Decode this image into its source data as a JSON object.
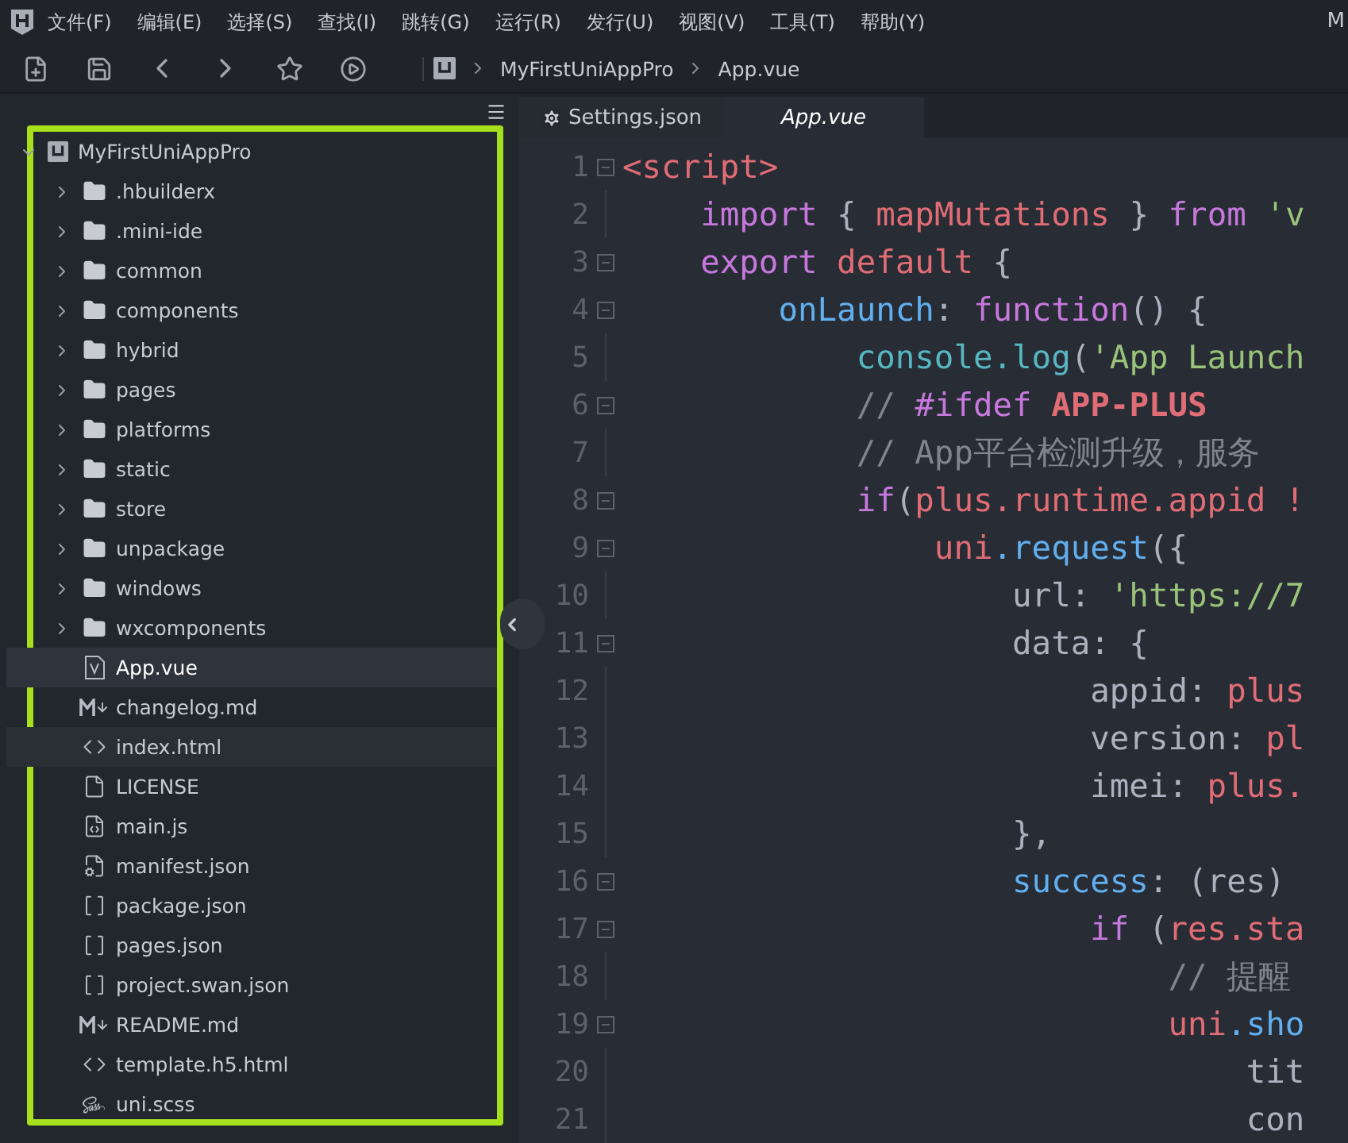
{
  "window": {
    "title": "M"
  },
  "menu": [
    "文件(F)",
    "编辑(E)",
    "选择(S)",
    "查找(I)",
    "跳转(G)",
    "运行(R)",
    "发行(U)",
    "视图(V)",
    "工具(T)",
    "帮助(Y)"
  ],
  "breadcrumb": [
    "MyFirstUniAppPro",
    "App.vue"
  ],
  "tabs": [
    {
      "label": "Settings.json",
      "kind": "settings",
      "selected": false,
      "preview": false
    },
    {
      "label": "App.vue",
      "kind": "file",
      "selected": true,
      "preview": true
    }
  ],
  "tree": {
    "label": "MyFirstUniAppPro",
    "expanded": true,
    "children": [
      {
        "label": ".hbuilderx",
        "kind": "folder",
        "expanded": false,
        "selected": false,
        "hovered": false
      },
      {
        "label": ".mini-ide",
        "kind": "folder",
        "expanded": false,
        "selected": false,
        "hovered": false
      },
      {
        "label": "common",
        "kind": "folder",
        "expanded": false,
        "selected": false,
        "hovered": false
      },
      {
        "label": "components",
        "kind": "folder",
        "expanded": false,
        "selected": false,
        "hovered": false
      },
      {
        "label": "hybrid",
        "kind": "folder",
        "expanded": false,
        "selected": false,
        "hovered": false
      },
      {
        "label": "pages",
        "kind": "folder",
        "expanded": false,
        "selected": false,
        "hovered": false
      },
      {
        "label": "platforms",
        "kind": "folder",
        "expanded": false,
        "selected": false,
        "hovered": false
      },
      {
        "label": "static",
        "kind": "folder",
        "expanded": false,
        "selected": false,
        "hovered": false
      },
      {
        "label": "store",
        "kind": "folder",
        "expanded": false,
        "selected": false,
        "hovered": false
      },
      {
        "label": "unpackage",
        "kind": "folder",
        "expanded": false,
        "selected": false,
        "hovered": false
      },
      {
        "label": "windows",
        "kind": "folder",
        "expanded": false,
        "selected": false,
        "hovered": false
      },
      {
        "label": "wxcomponents",
        "kind": "folder",
        "expanded": false,
        "selected": false,
        "hovered": false
      },
      {
        "label": "App.vue",
        "kind": "vue",
        "selected": true,
        "hovered": false
      },
      {
        "label": "changelog.md",
        "kind": "markdown",
        "selected": false,
        "hovered": false
      },
      {
        "label": "index.html",
        "kind": "html",
        "selected": false,
        "hovered": true
      },
      {
        "label": "LICENSE",
        "kind": "plain",
        "selected": false,
        "hovered": false
      },
      {
        "label": "main.js",
        "kind": "js",
        "selected": false,
        "hovered": false
      },
      {
        "label": "manifest.json",
        "kind": "manifest",
        "selected": false,
        "hovered": false
      },
      {
        "label": "package.json",
        "kind": "json",
        "selected": false,
        "hovered": false
      },
      {
        "label": "pages.json",
        "kind": "json",
        "selected": false,
        "hovered": false
      },
      {
        "label": "project.swan.json",
        "kind": "json",
        "selected": false,
        "hovered": false
      },
      {
        "label": "README.md",
        "kind": "markdown",
        "selected": false,
        "hovered": false
      },
      {
        "label": "template.h5.html",
        "kind": "html",
        "selected": false,
        "hovered": false
      },
      {
        "label": "uni.scss",
        "kind": "sass",
        "selected": false,
        "hovered": false
      }
    ]
  },
  "editor": {
    "lines": [
      {
        "number": "1",
        "fold": true,
        "tokens": [
          {
            "t": "<script>",
            "color": "#e06c75",
            "bold": false
          }
        ]
      },
      {
        "number": "2",
        "fold": false,
        "tokens": [
          {
            "t": "    import",
            "color": "#c678dd",
            "bold": false
          },
          {
            "t": " { ",
            "color": "#abb2bf",
            "bold": false
          },
          {
            "t": "mapMutations",
            "color": "#e06c75",
            "bold": false
          },
          {
            "t": " } ",
            "color": "#abb2bf",
            "bold": false
          },
          {
            "t": "from",
            "color": "#c678dd",
            "bold": false
          },
          {
            "t": " 'v",
            "color": "#98c379",
            "bold": false
          }
        ]
      },
      {
        "number": "3",
        "fold": true,
        "tokens": [
          {
            "t": "    export",
            "color": "#c678dd",
            "bold": false
          },
          {
            "t": " default",
            "color": "#e06c75",
            "bold": false
          },
          {
            "t": " {",
            "color": "#abb2bf",
            "bold": false
          }
        ]
      },
      {
        "number": "4",
        "fold": true,
        "tokens": [
          {
            "t": "        onLaunch",
            "color": "#61afef",
            "bold": false
          },
          {
            "t": ": ",
            "color": "#abb2bf",
            "bold": false
          },
          {
            "t": "function",
            "color": "#c678dd",
            "bold": false
          },
          {
            "t": "() {",
            "color": "#abb2bf",
            "bold": false
          }
        ]
      },
      {
        "number": "5",
        "fold": false,
        "tokens": [
          {
            "t": "            console.log",
            "color": "#56b6c2",
            "bold": false
          },
          {
            "t": "(",
            "color": "#abb2bf",
            "bold": false
          },
          {
            "t": "'App Launch",
            "color": "#98c379",
            "bold": false
          }
        ]
      },
      {
        "number": "6",
        "fold": true,
        "tokens": [
          {
            "t": "            // ",
            "color": "#7f848e",
            "bold": false
          },
          {
            "t": "#ifdef",
            "color": "#c678dd",
            "bold": false
          },
          {
            "t": " APP-PLUS",
            "color": "#e06c75",
            "bold": true
          }
        ]
      },
      {
        "number": "7",
        "fold": false,
        "tokens": [
          {
            "t": "            // App平台检测升级，服务",
            "color": "#7f848e",
            "bold": false
          }
        ]
      },
      {
        "number": "8",
        "fold": true,
        "tokens": [
          {
            "t": "            if",
            "color": "#c678dd",
            "bold": false
          },
          {
            "t": "(",
            "color": "#abb2bf",
            "bold": false
          },
          {
            "t": "plus.runtime.appid !",
            "color": "#e06c75",
            "bold": false
          }
        ]
      },
      {
        "number": "9",
        "fold": true,
        "tokens": [
          {
            "t": "                uni",
            "color": "#e06c75",
            "bold": false
          },
          {
            "t": ".request",
            "color": "#61afef",
            "bold": false
          },
          {
            "t": "({",
            "color": "#abb2bf",
            "bold": false
          }
        ]
      },
      {
        "number": "10",
        "fold": false,
        "tokens": [
          {
            "t": "                    url: ",
            "color": "#abb2bf",
            "bold": false
          },
          {
            "t": "'https://7",
            "color": "#98c379",
            "bold": false
          }
        ]
      },
      {
        "number": "11",
        "fold": true,
        "tokens": [
          {
            "t": "                    data: {",
            "color": "#abb2bf",
            "bold": false
          }
        ]
      },
      {
        "number": "12",
        "fold": false,
        "tokens": [
          {
            "t": "                        appid: ",
            "color": "#abb2bf",
            "bold": false
          },
          {
            "t": "plus",
            "color": "#e06c75",
            "bold": false
          }
        ]
      },
      {
        "number": "13",
        "fold": false,
        "tokens": [
          {
            "t": "                        version: ",
            "color": "#abb2bf",
            "bold": false
          },
          {
            "t": "pl",
            "color": "#e06c75",
            "bold": false
          }
        ]
      },
      {
        "number": "14",
        "fold": false,
        "tokens": [
          {
            "t": "                        imei: ",
            "color": "#abb2bf",
            "bold": false
          },
          {
            "t": "plus.",
            "color": "#e06c75",
            "bold": false
          }
        ]
      },
      {
        "number": "15",
        "fold": false,
        "tokens": [
          {
            "t": "                    },",
            "color": "#abb2bf",
            "bold": false
          }
        ]
      },
      {
        "number": "16",
        "fold": true,
        "tokens": [
          {
            "t": "                    success",
            "color": "#61afef",
            "bold": false
          },
          {
            "t": ": (res)",
            "color": "#abb2bf",
            "bold": false
          }
        ]
      },
      {
        "number": "17",
        "fold": true,
        "tokens": [
          {
            "t": "                        if",
            "color": "#c678dd",
            "bold": false
          },
          {
            "t": " (",
            "color": "#abb2bf",
            "bold": false
          },
          {
            "t": "res.sta",
            "color": "#e06c75",
            "bold": false
          }
        ]
      },
      {
        "number": "18",
        "fold": false,
        "tokens": [
          {
            "t": "                            // 提醒",
            "color": "#7f848e",
            "bold": false
          }
        ]
      },
      {
        "number": "19",
        "fold": true,
        "tokens": [
          {
            "t": "                            uni",
            "color": "#e06c75",
            "bold": false
          },
          {
            "t": ".sho",
            "color": "#61afef",
            "bold": false
          }
        ]
      },
      {
        "number": "20",
        "fold": false,
        "tokens": [
          {
            "t": "                                tit",
            "color": "#abb2bf",
            "bold": false
          }
        ]
      },
      {
        "number": "21",
        "fold": false,
        "tokens": [
          {
            "t": "                                con",
            "color": "#abb2bf",
            "bold": false
          }
        ]
      }
    ]
  }
}
